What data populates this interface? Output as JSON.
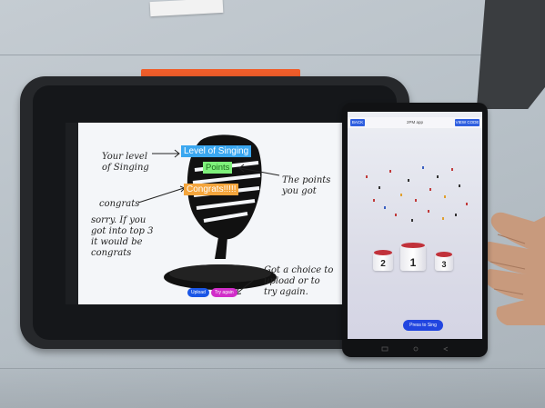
{
  "tablet": {
    "labels": {
      "level": "Level of Singing",
      "points": "Points",
      "congrats": "Congrats!!!!!"
    },
    "buttons": {
      "upload": "Upload",
      "try_again": "Try again"
    },
    "handwriting": {
      "level_note": "Your level\nof Singing",
      "points_note": "The points\nyou got",
      "congrats_note": "congrats",
      "sorry_note": "sorry. If you\ngot into top 3\nit would be\ncongrats",
      "choice_note": "Got a choice to\nupload or to\ntry again."
    }
  },
  "phone": {
    "appbar": {
      "back": "BACK",
      "title": "2PM app",
      "view_code": "VIEW CODE"
    },
    "podium": {
      "first": "1",
      "second": "2",
      "third": "3",
      "accent_color": "#c1313a"
    },
    "press_button": "Press to Sing"
  }
}
